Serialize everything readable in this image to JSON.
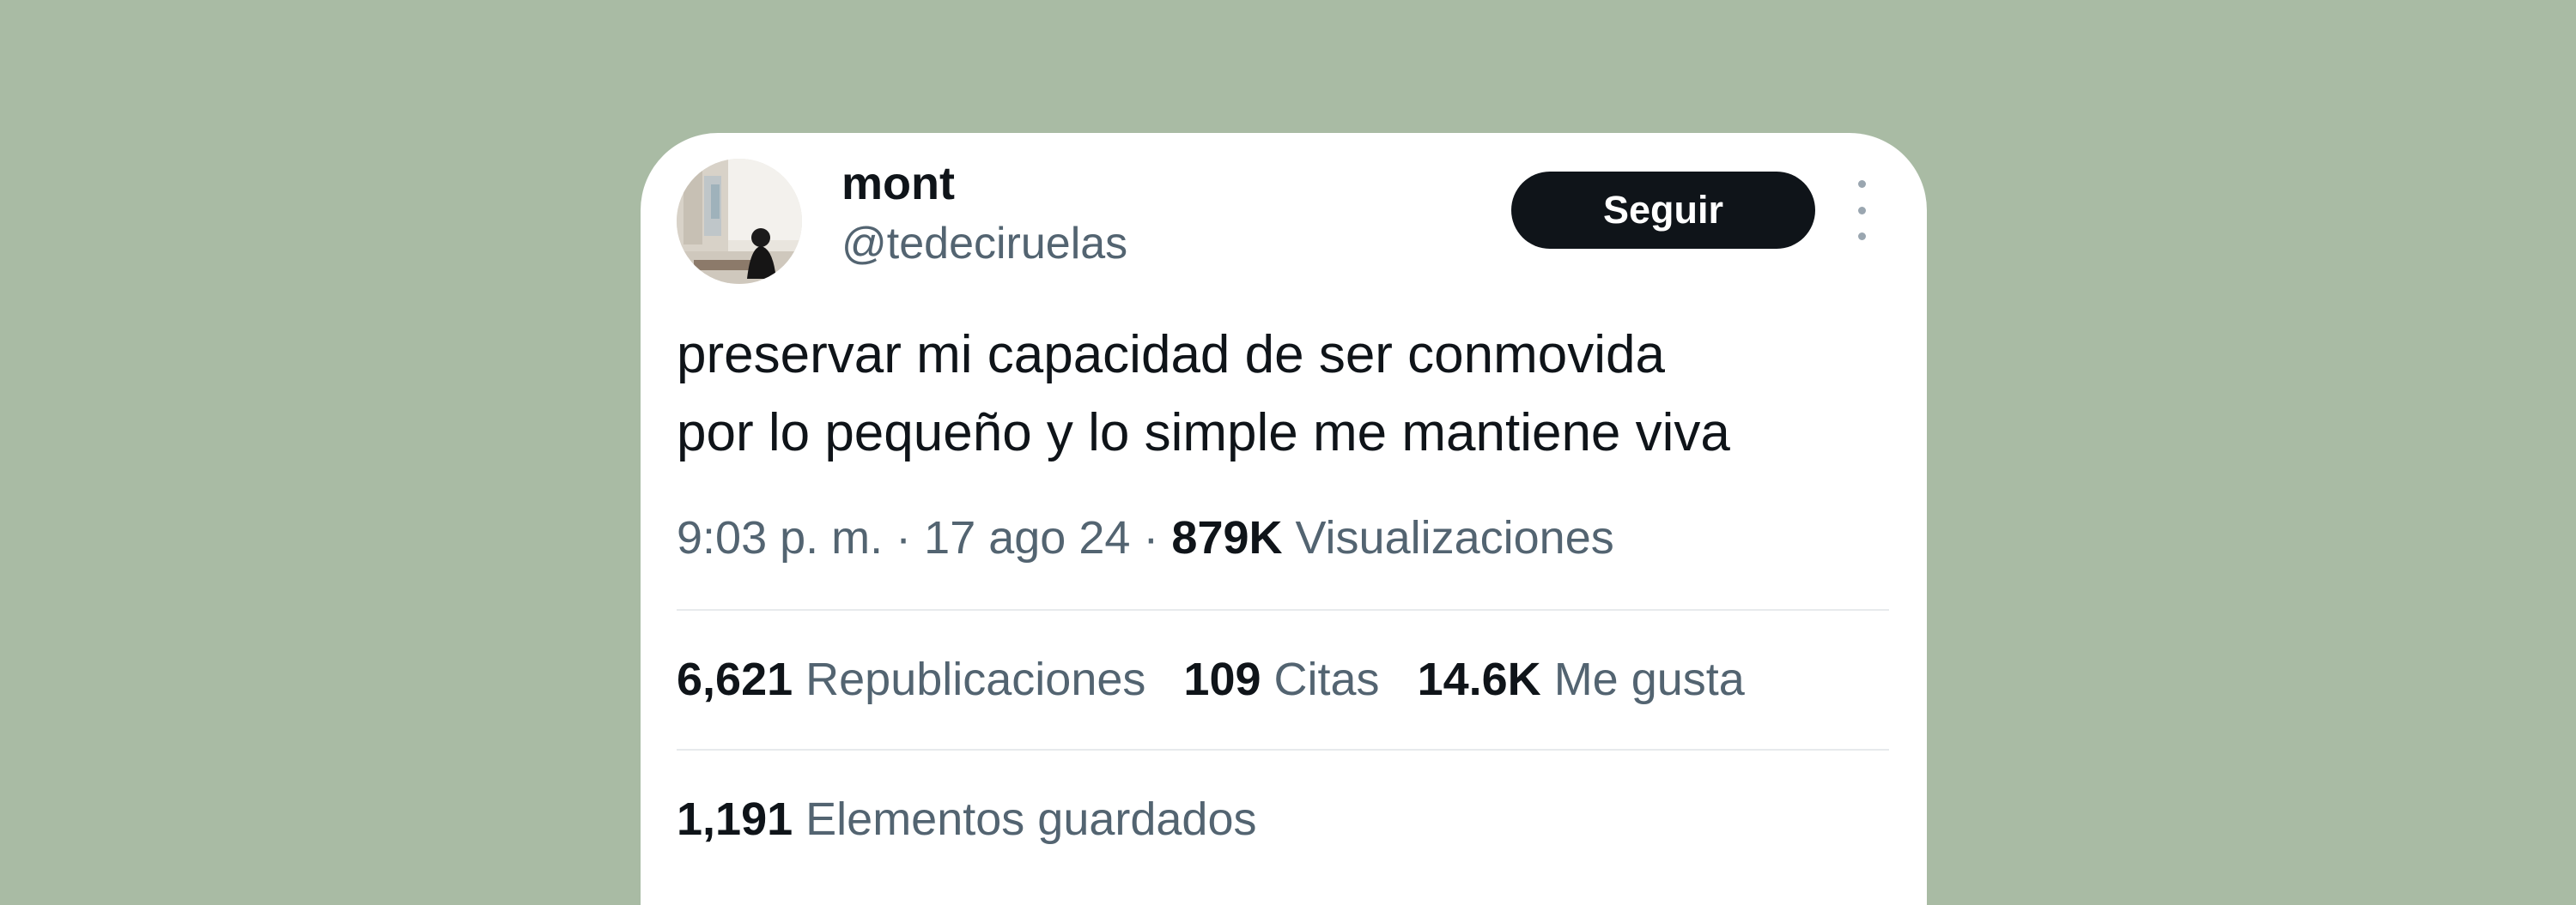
{
  "tweet": {
    "author": {
      "name": "mont",
      "handle": "@tedeciruelas"
    },
    "follow_label": "Seguir",
    "more_icon": "more-vertical-icon",
    "text_lines": [
      "preservar mi capacidad de ser conmovida",
      "por lo pequeño y lo simple me mantiene viva"
    ],
    "time": "9:03 p. m.",
    "date": "17 ago 24",
    "separator": "·",
    "views": {
      "count": "879K",
      "label": "Visualizaciones"
    },
    "stats": {
      "reposts": {
        "count": "6,621",
        "label": "Republicaciones"
      },
      "quotes": {
        "count": "109",
        "label": "Citas"
      },
      "likes": {
        "count": "14.6K",
        "label": "Me gusta"
      }
    },
    "bookmarks": {
      "count": "1,191",
      "label": "Elementos guardados"
    }
  },
  "colors": {
    "background": "#a9bba4",
    "card": "#ffffff",
    "primary_text": "#0f1419",
    "secondary_text": "#536471",
    "button_bg": "#0f1419",
    "button_text": "#ffffff",
    "divider": "#e7eaec"
  }
}
